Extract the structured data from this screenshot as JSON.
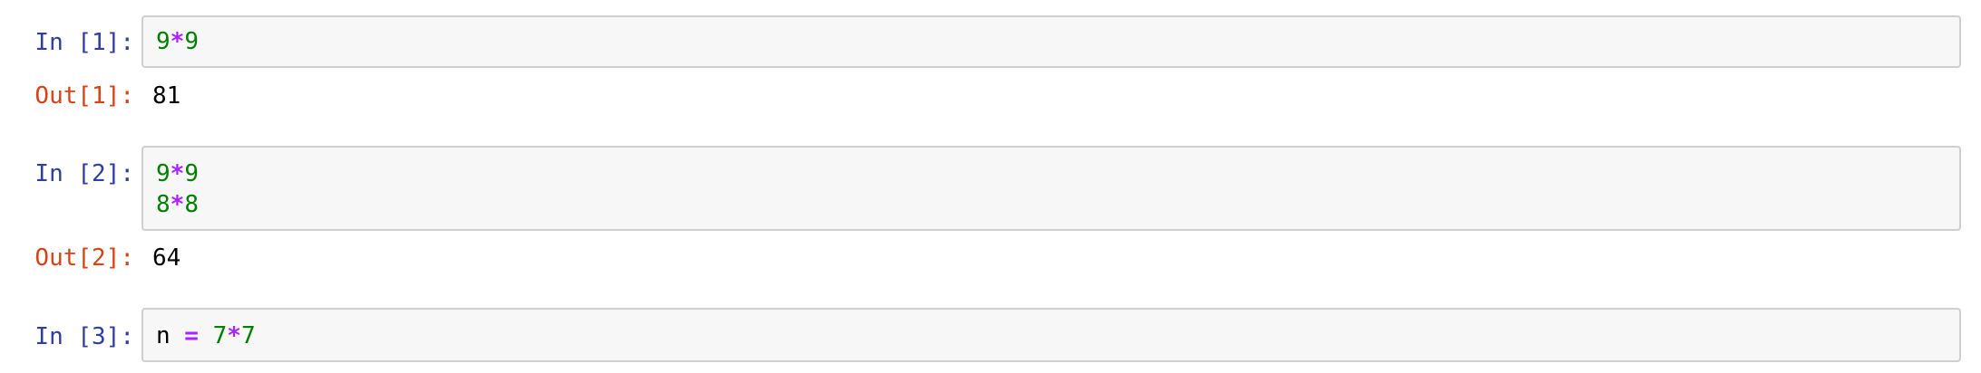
{
  "cells": [
    {
      "prompt": "In [1]:",
      "lines": [
        {
          "a": "9",
          "op": "*",
          "b": "9"
        }
      ],
      "output_prompt": "Out[1]:",
      "output": "81"
    },
    {
      "prompt": "In [2]:",
      "lines": [
        {
          "a": "9",
          "op": "*",
          "b": "9"
        },
        {
          "a": "8",
          "op": "*",
          "b": "8"
        }
      ],
      "output_prompt": "Out[2]:",
      "output": "64"
    },
    {
      "prompt": "In [3]:",
      "assign": {
        "name": "n",
        "eq": " = ",
        "a": "7",
        "op": "*",
        "b": "7"
      }
    }
  ],
  "colors": {
    "in_prompt": "#303f9f",
    "out_prompt": "#d84315",
    "number": "#008000",
    "operator": "#aa22ff",
    "cell_background": "#f7f7f7",
    "cell_border": "#cfcfcf"
  }
}
